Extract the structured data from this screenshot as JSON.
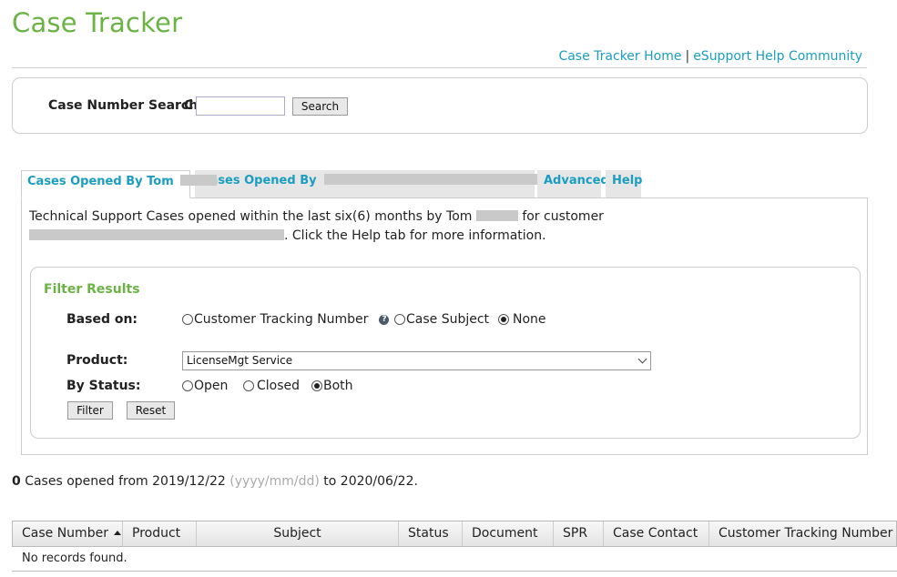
{
  "header": {
    "title": "Case Tracker",
    "links": [
      "Case Tracker Home",
      "eSupport Help Community"
    ],
    "link_separator": "|"
  },
  "search": {
    "label": "Case Number Search",
    "prefix": "C",
    "value": "",
    "button": "Search"
  },
  "tabs": [
    {
      "label": "Cases Opened By Tom",
      "active": true
    },
    {
      "label": "Cases Opened By",
      "active": false
    },
    {
      "label": "Advanced",
      "active": false
    },
    {
      "label": "Help",
      "active": false
    }
  ],
  "description": {
    "part1": "Technical Support Cases opened within the last six(6) months by Tom",
    "part2": "for customer",
    "part3": ". Click the Help tab for more information."
  },
  "filter": {
    "title": "Filter Results",
    "based_on_label": "Based on:",
    "based_on_options": [
      "Customer Tracking Number",
      "Case Subject",
      "None"
    ],
    "based_on_selected": "None",
    "product_label": "Product:",
    "product_value": "LicenseMgt Service",
    "status_label": "By Status:",
    "status_options": [
      "Open",
      "Closed",
      "Both"
    ],
    "status_selected": "Both",
    "filter_button": "Filter",
    "reset_button": "Reset"
  },
  "summary": {
    "count": "0",
    "text1": "Cases opened from 2019/12/22",
    "hint": "(yyyy/mm/dd)",
    "text2": "to 2020/06/22."
  },
  "grid": {
    "columns": [
      "Case Number",
      "Product",
      "Subject",
      "Status",
      "Document",
      "SPR",
      "Case Contact",
      "Customer Tracking Number"
    ],
    "empty_message": "No records found."
  },
  "colors": {
    "brand_green": "#6ab344",
    "link_blue": "#1a9dc0",
    "redaction_gray": "#c9c9c9"
  }
}
